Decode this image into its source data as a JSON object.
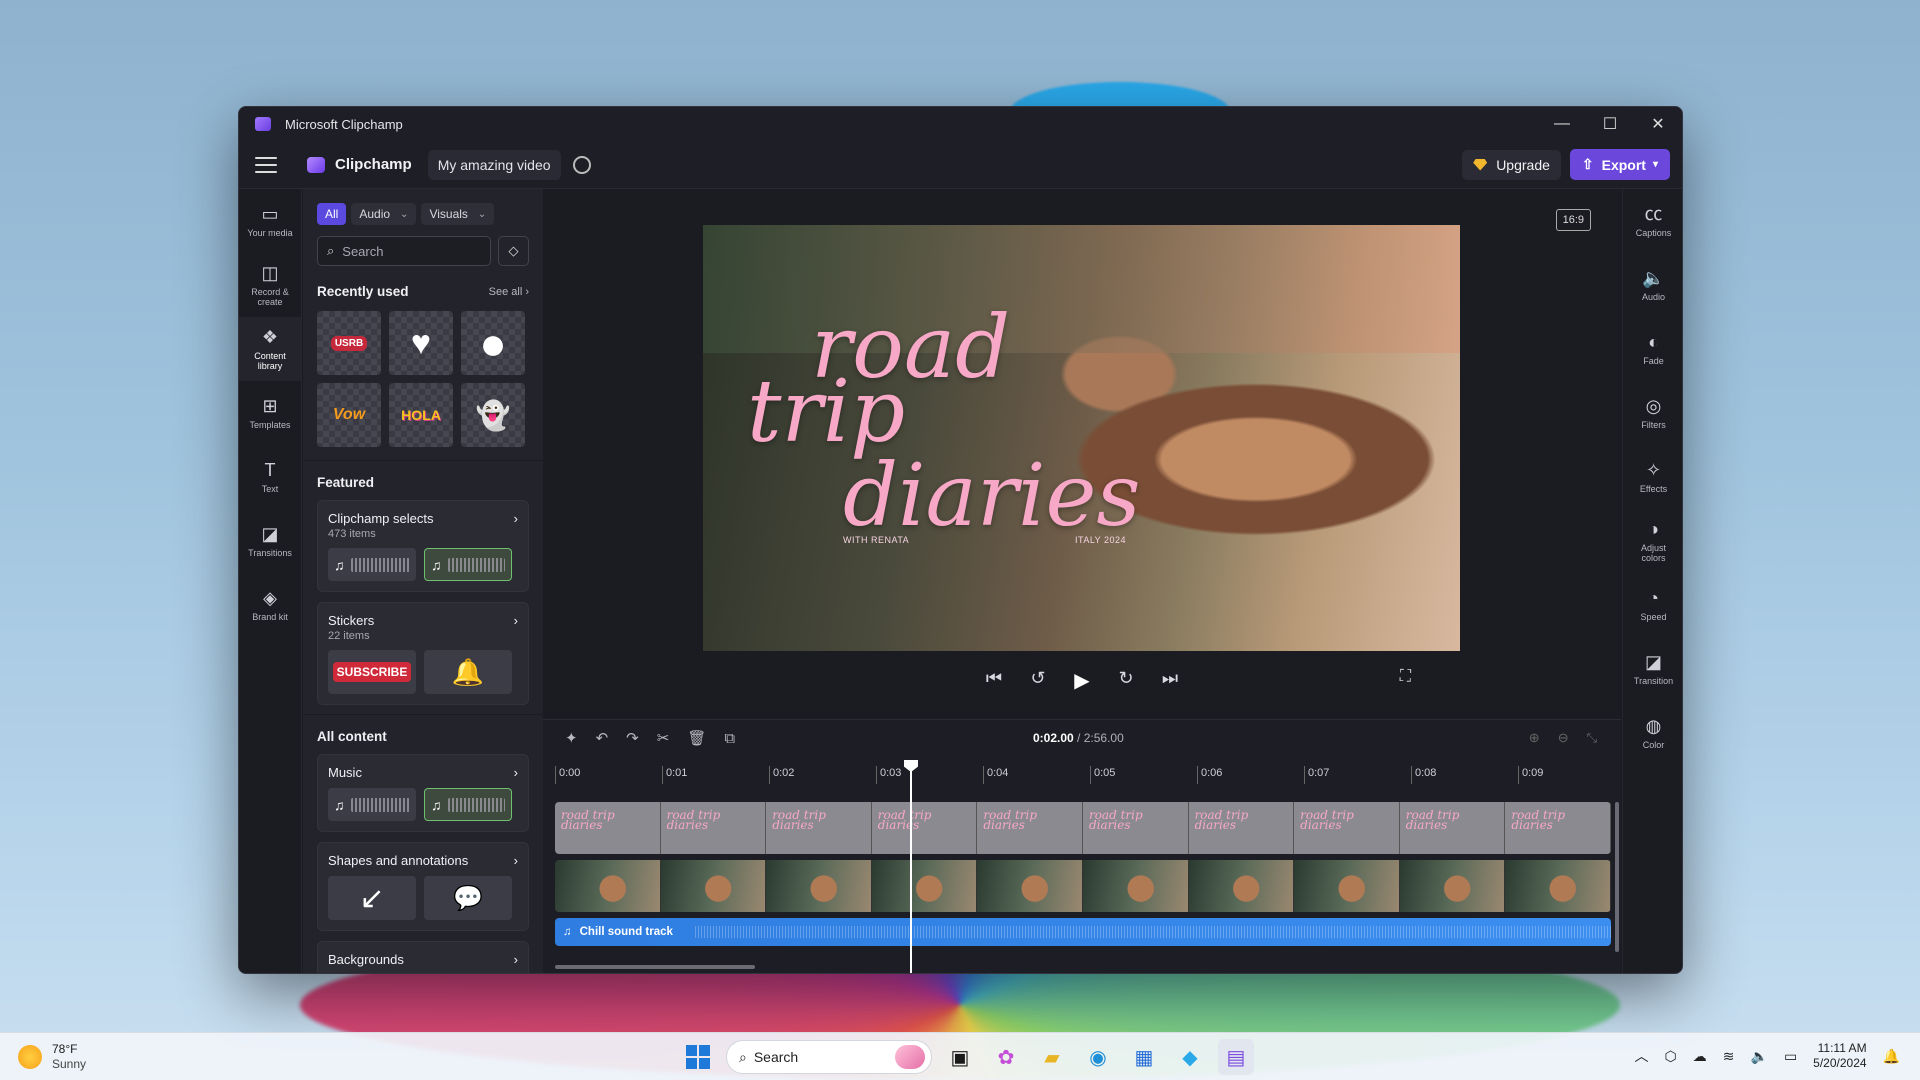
{
  "window": {
    "title": "Microsoft Clipchamp",
    "minimize": "—",
    "maximize": "☐",
    "close": "✕"
  },
  "topbar": {
    "brand": "Clipchamp",
    "project_name": "My amazing video",
    "upgrade_label": "Upgrade",
    "export_label": "Export"
  },
  "leftnav": [
    {
      "icon": "folder-icon",
      "glyph": "▭",
      "label": "Your media"
    },
    {
      "icon": "camera-icon",
      "glyph": "◫",
      "label": "Record & create"
    },
    {
      "icon": "content-library-icon",
      "glyph": "❖",
      "label": "Content library"
    },
    {
      "icon": "templates-icon",
      "glyph": "⊞",
      "label": "Templates"
    },
    {
      "icon": "text-icon",
      "glyph": "T",
      "label": "Text"
    },
    {
      "icon": "transitions-icon",
      "glyph": "◪",
      "label": "Transitions"
    },
    {
      "icon": "brand-kit-icon",
      "glyph": "◈",
      "label": "Brand kit"
    }
  ],
  "panel": {
    "filters": {
      "all": "All",
      "audio": "Audio",
      "visuals": "Visuals"
    },
    "search_placeholder": "Search",
    "recently_used": {
      "title": "Recently used",
      "see_all": "See all",
      "items": [
        "USRB",
        "♥",
        "●",
        "Vow",
        "HOLA",
        "👻"
      ]
    },
    "featured_title": "Featured",
    "featured": [
      {
        "title": "Clipchamp selects",
        "subtitle": "473 items"
      },
      {
        "title": "Stickers",
        "subtitle": "22 items",
        "thumb1": "SUBSCRIBE",
        "thumb2": "🔔"
      }
    ],
    "all_content_title": "All content",
    "all_content": [
      {
        "title": "Music"
      },
      {
        "title": "Shapes and annotations",
        "thumb1": "↙",
        "thumb2": "💬"
      },
      {
        "title": "Backgrounds"
      }
    ]
  },
  "preview": {
    "aspect_ratio": "16:9",
    "title_line1": "road",
    "title_line2": "trip",
    "title_line3": "diaries",
    "subtitle_left": "WITH RENATA",
    "subtitle_right": "ITALY 2024"
  },
  "rightbar": [
    {
      "icon": "captions-icon",
      "glyph": "㏄",
      "label": "Captions"
    },
    {
      "icon": "audio-icon",
      "glyph": "🔈",
      "label": "Audio"
    },
    {
      "icon": "fade-icon",
      "glyph": "◐",
      "label": "Fade"
    },
    {
      "icon": "filters-icon",
      "glyph": "◎",
      "label": "Filters"
    },
    {
      "icon": "effects-icon",
      "glyph": "✧",
      "label": "Effects"
    },
    {
      "icon": "adjust-colors-icon",
      "glyph": "◑",
      "label": "Adjust colors"
    },
    {
      "icon": "speed-icon",
      "glyph": "◔",
      "label": "Speed"
    },
    {
      "icon": "transition-icon",
      "glyph": "◪",
      "label": "Transition"
    },
    {
      "icon": "color-icon",
      "glyph": "◍",
      "label": "Color"
    }
  ],
  "timeline": {
    "current_time": "0:02.00",
    "total_time": "/ 2:56.00",
    "ticks": [
      "0:00",
      "0:01",
      "0:02",
      "0:03",
      "0:04",
      "0:05",
      "0:06",
      "0:07",
      "0:08",
      "0:09"
    ],
    "text_clip_label": "road trip diaries",
    "audio_label": "Chill sound track"
  },
  "taskbar": {
    "temperature": "78°F",
    "condition": "Sunny",
    "search_label": "Search",
    "time": "11:11 AM",
    "date": "5/20/2024"
  },
  "colors": {
    "accent": "#6b47dc",
    "audio_track": "#2f7de0",
    "title_pink": "#f7a8c6"
  }
}
